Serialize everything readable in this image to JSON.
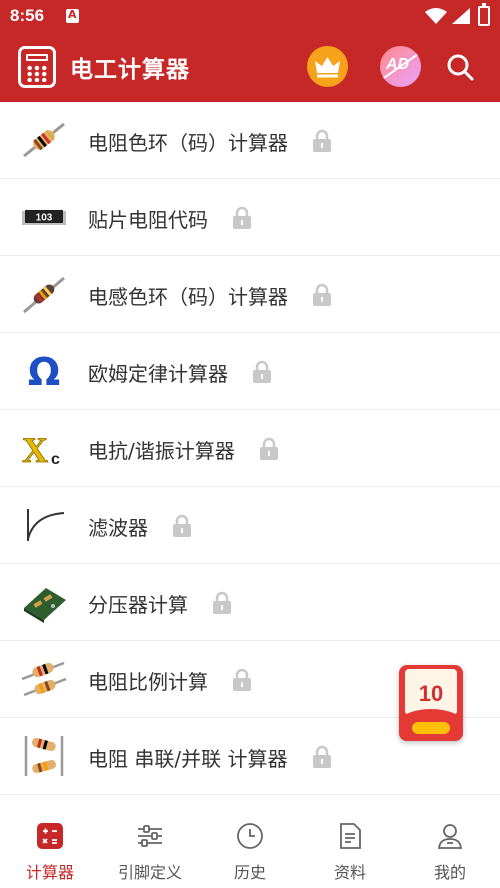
{
  "status_bar": {
    "time": "8:56"
  },
  "app_bar": {
    "title": "电工计算器"
  },
  "items": [
    {
      "label": "电阻色环（码）计算器",
      "icon": "resistor-color-icon"
    },
    {
      "label": "贴片电阻代码",
      "icon": "smd-resistor-icon",
      "chip_text": "103"
    },
    {
      "label": "电感色环（码）计算器",
      "icon": "inductor-color-icon"
    },
    {
      "label": "欧姆定律计算器",
      "icon": "ohm-icon",
      "glyph": "Ω"
    },
    {
      "label": "电抗/谐振计算器",
      "icon": "reactance-icon",
      "glyph": "X",
      "sub": "c"
    },
    {
      "label": "滤波器",
      "icon": "filter-curve-icon"
    },
    {
      "label": "分压器计算",
      "icon": "voltage-divider-icon"
    },
    {
      "label": "电阻比例计算",
      "icon": "resistor-ratio-icon"
    },
    {
      "label": "电阻 串联/并联 计算器",
      "icon": "series-parallel-icon"
    }
  ],
  "promo": {
    "amount": "10"
  },
  "bottom_nav": [
    {
      "label": "计算器",
      "active": true
    },
    {
      "label": "引脚定义",
      "active": false
    },
    {
      "label": "历史",
      "active": false
    },
    {
      "label": "资料",
      "active": false
    },
    {
      "label": "我的",
      "active": false
    }
  ],
  "colors": {
    "primary": "#c62828",
    "lock": "#c8c8c8",
    "crown_bg": "#f7a21b",
    "ohm_blue": "#1e4fc4",
    "xc_yellow": "#e6b800"
  }
}
